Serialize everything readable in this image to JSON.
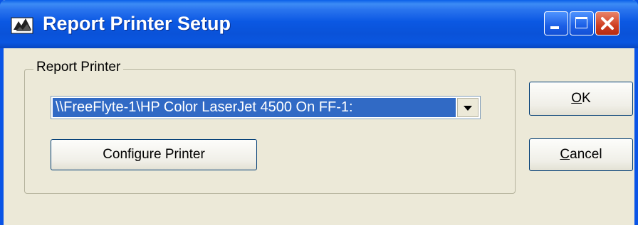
{
  "window": {
    "title": "Report Printer Setup",
    "icons": {
      "app": "printer-app-icon",
      "minimize": "minimize-icon",
      "maximize": "maximize-icon",
      "close": "close-icon"
    },
    "colors": {
      "titlebar": "#0a54e6",
      "background": "#ece9d8",
      "selection": "#316ac5",
      "close": "#cf3e22"
    }
  },
  "group": {
    "label": "Report Printer",
    "printer_select": {
      "selected_value": "\\\\FreeFlyte-1\\HP Color LaserJet 4500 On FF-1:"
    },
    "configure_button": "Configure Printer"
  },
  "actions": {
    "ok": {
      "mnemonic": "O",
      "rest": "K"
    },
    "cancel": {
      "mnemonic": "C",
      "rest": "ancel"
    }
  }
}
